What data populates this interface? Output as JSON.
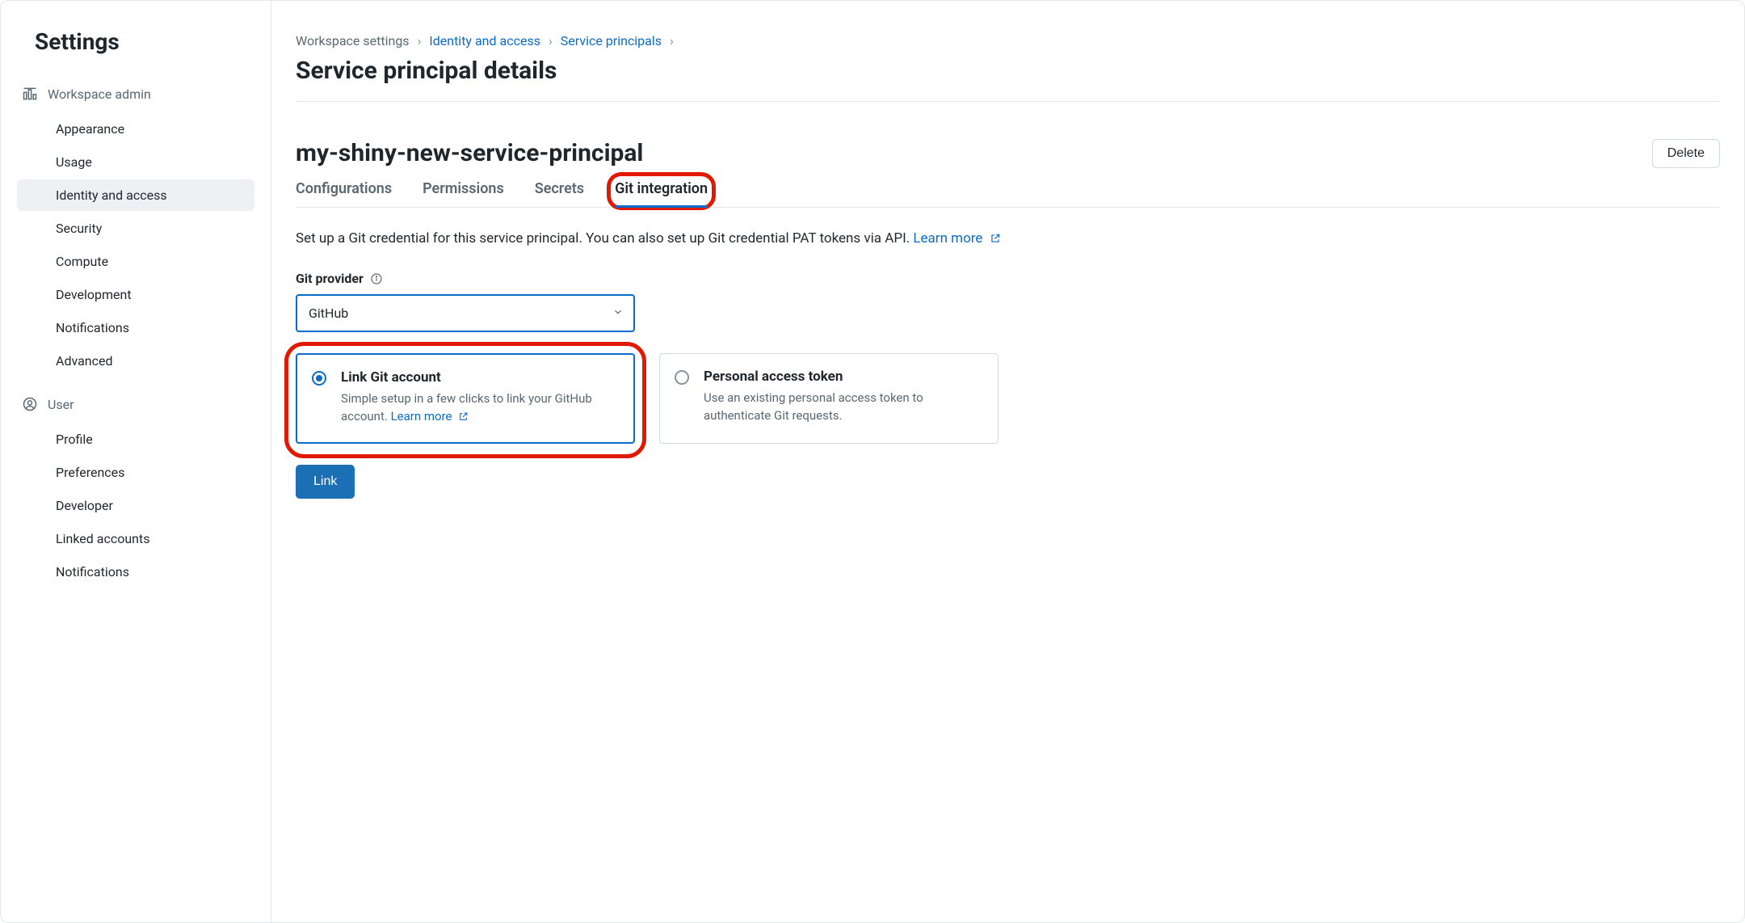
{
  "sidebar": {
    "title": "Settings",
    "sections": [
      {
        "label": "Workspace admin",
        "icon": "workspace-admin-icon",
        "items": [
          {
            "label": "Appearance",
            "active": false
          },
          {
            "label": "Usage",
            "active": false
          },
          {
            "label": "Identity and access",
            "active": true
          },
          {
            "label": "Security",
            "active": false
          },
          {
            "label": "Compute",
            "active": false
          },
          {
            "label": "Development",
            "active": false
          },
          {
            "label": "Notifications",
            "active": false
          },
          {
            "label": "Advanced",
            "active": false
          }
        ]
      },
      {
        "label": "User",
        "icon": "user-icon",
        "items": [
          {
            "label": "Profile",
            "active": false
          },
          {
            "label": "Preferences",
            "active": false
          },
          {
            "label": "Developer",
            "active": false
          },
          {
            "label": "Linked accounts",
            "active": false
          },
          {
            "label": "Notifications",
            "active": false
          }
        ]
      }
    ]
  },
  "breadcrumb": {
    "items": [
      {
        "label": "Workspace settings",
        "link": false
      },
      {
        "label": "Identity and access",
        "link": true
      },
      {
        "label": "Service principals",
        "link": true
      }
    ]
  },
  "page_title": "Service principal details",
  "entity_name": "my-shiny-new-service-principal",
  "delete_label": "Delete",
  "tabs": [
    {
      "label": "Configurations",
      "active": false
    },
    {
      "label": "Permissions",
      "active": false
    },
    {
      "label": "Secrets",
      "active": false
    },
    {
      "label": "Git integration",
      "active": true
    }
  ],
  "helper_text": "Set up a Git credential for this service principal. You can also set up Git credential PAT tokens via API. ",
  "learn_more_label": "Learn more",
  "git_provider_label": "Git provider",
  "git_provider_value": "GitHub",
  "radio_options": [
    {
      "title": "Link Git account",
      "desc_prefix": "Simple setup in a few clicks to link your GitHub account. ",
      "learn_more": "Learn more",
      "selected": true
    },
    {
      "title": "Personal access token",
      "desc": "Use an existing personal access token to authenticate Git requests.",
      "selected": false
    }
  ],
  "link_button": "Link"
}
